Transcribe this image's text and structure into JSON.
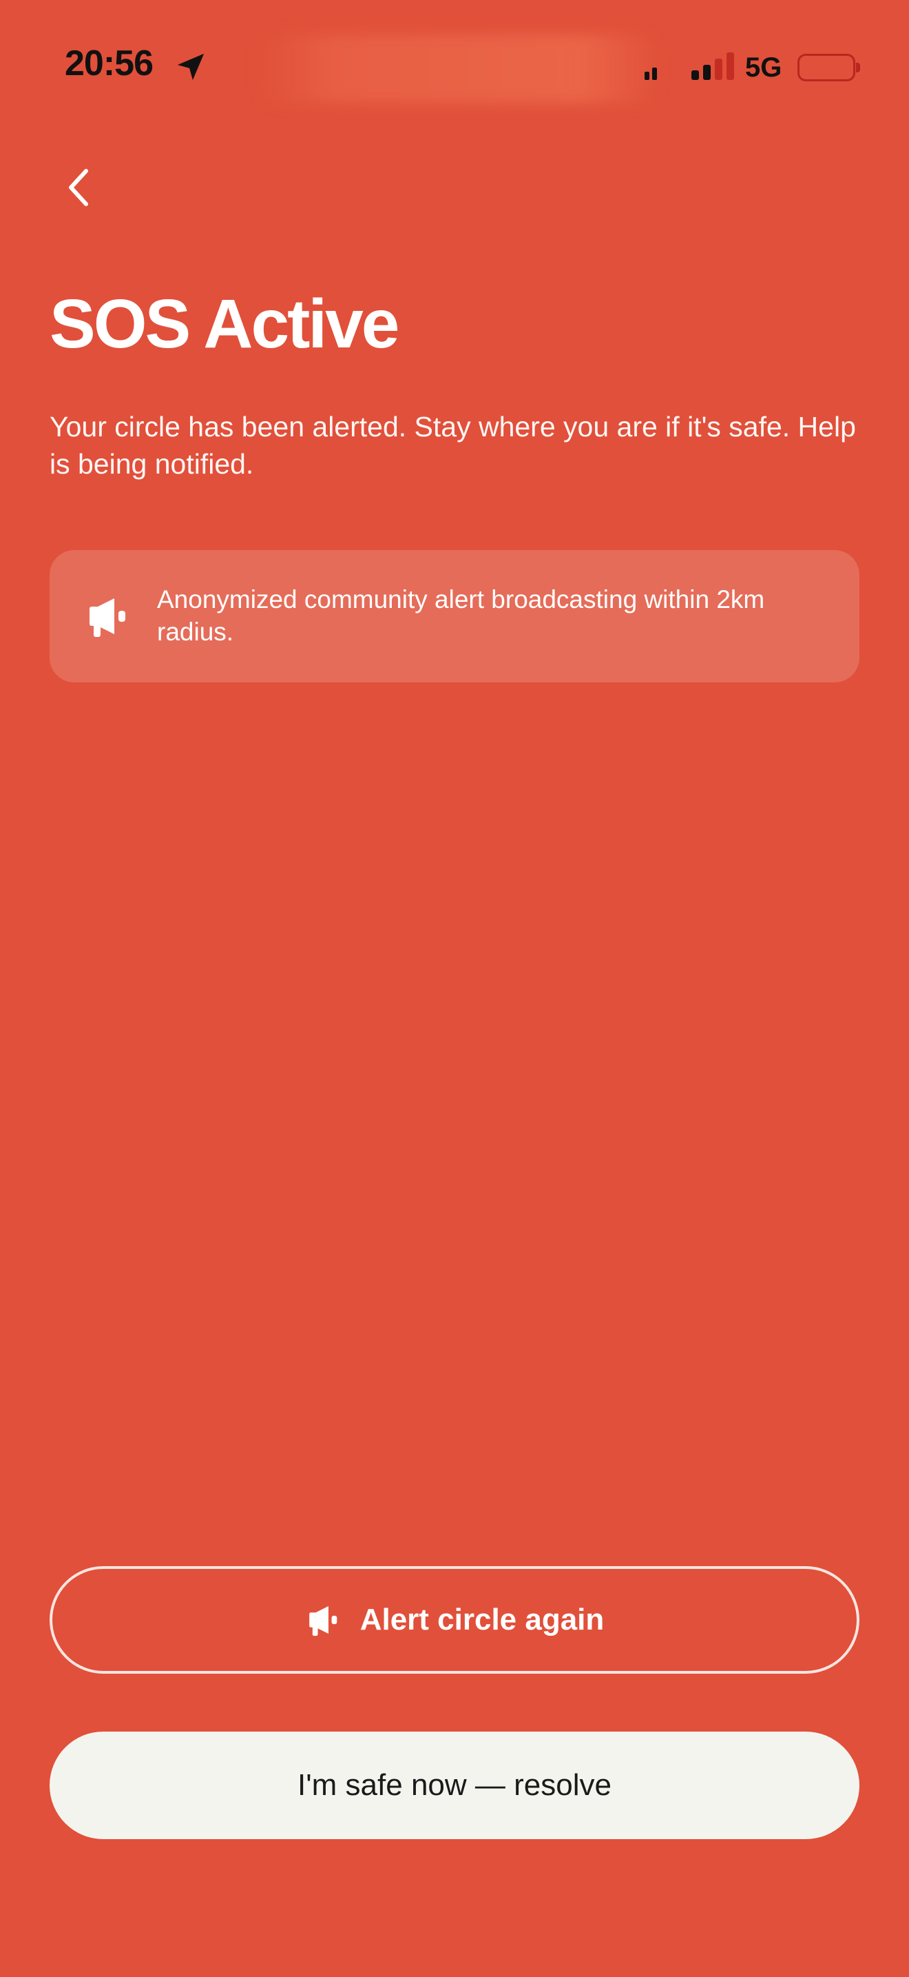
{
  "status_bar": {
    "time": "20:56",
    "network": "5G",
    "location_icon": "location-arrow-icon",
    "signal_icon": "cellular-signal-icon",
    "battery_icon": "battery-low-icon",
    "battery_color": "#B8271F"
  },
  "nav": {
    "back_icon": "chevron-left-icon"
  },
  "header": {
    "title": "SOS Active",
    "subtitle": "Your circle has been alerted. Stay where you are if it's safe. Help is being notified."
  },
  "info_card": {
    "icon": "megaphone-icon",
    "text": "Anonymized community alert broadcasting within 2km radius."
  },
  "actions": {
    "alert_again": {
      "icon": "megaphone-icon",
      "label": "Alert circle again"
    },
    "resolve": {
      "label": "I'm safe now — resolve"
    }
  },
  "colors": {
    "background": "#E1503A",
    "resolve_button_bg": "#F4F4EF",
    "text_primary": "#FFFFFF"
  }
}
